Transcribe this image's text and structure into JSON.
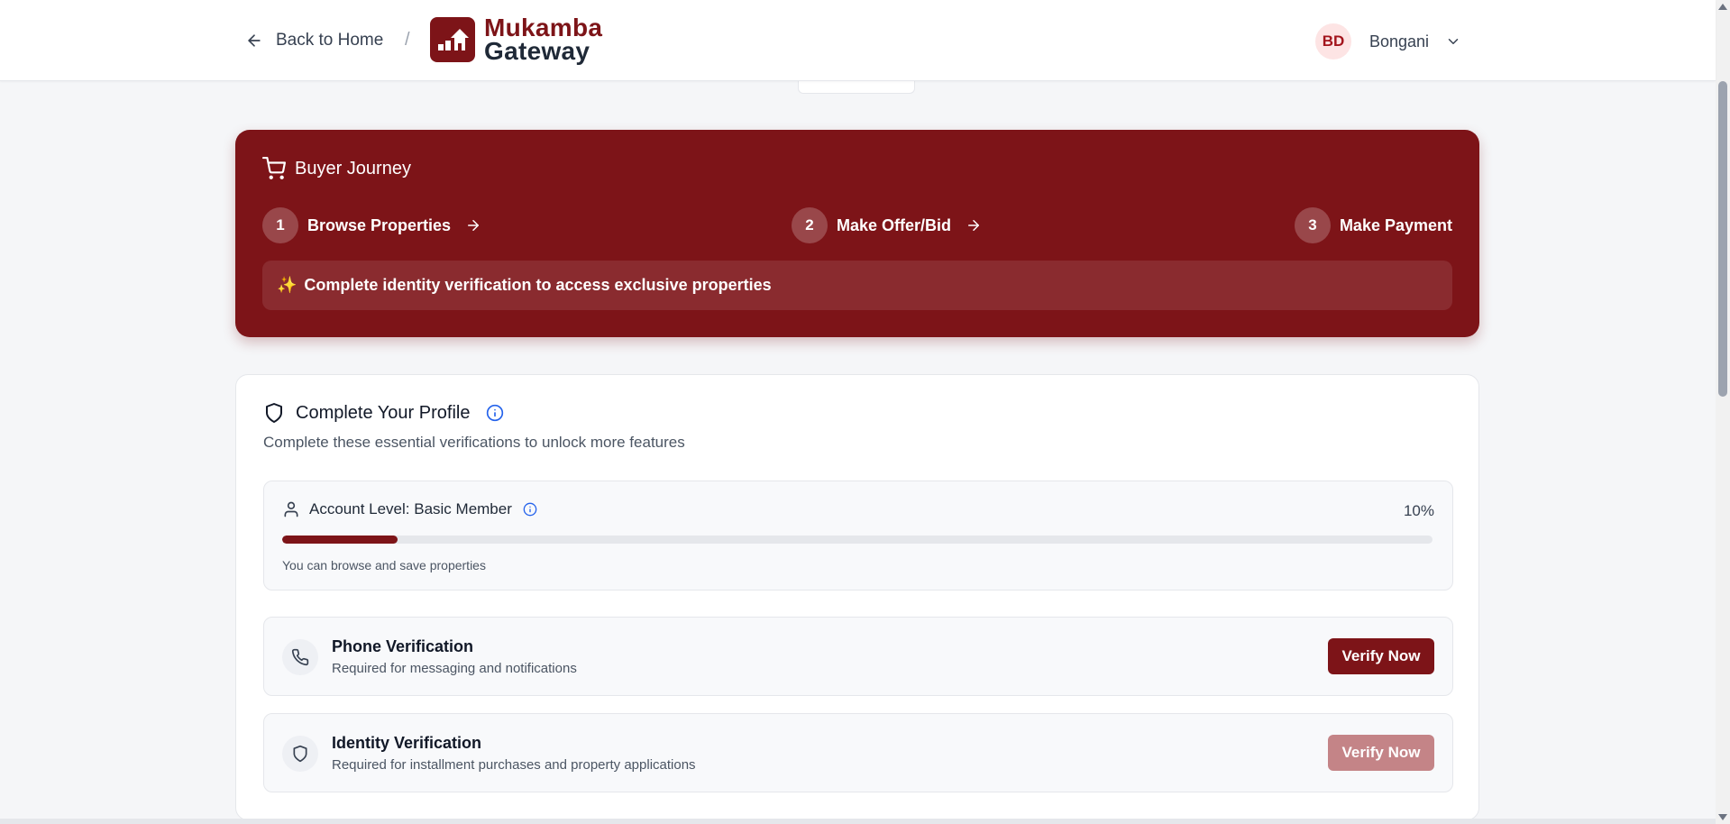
{
  "header": {
    "back_label": "Back to Home",
    "separator": "/",
    "logo_line1": "Mukamba",
    "logo_line2": "Gateway",
    "user_initials": "BD",
    "user_name": "Bongani"
  },
  "journey": {
    "title": "Buyer Journey",
    "steps": [
      {
        "number": "1",
        "label": "Browse Properties"
      },
      {
        "number": "2",
        "label": "Make Offer/Bid"
      },
      {
        "number": "3",
        "label": "Make Payment"
      }
    ],
    "note_icon": "✨",
    "note": "Complete identity verification to access exclusive properties"
  },
  "profile": {
    "title": "Complete Your Profile",
    "subtitle": "Complete these essential verifications to unlock more features",
    "level": {
      "label": "Account Level: Basic Member",
      "percent_label": "10%",
      "progress": 0.1,
      "description": "You can browse and save properties"
    },
    "verifications": [
      {
        "title": "Phone Verification",
        "description": "Required for messaging and notifications",
        "button": "Verify Now",
        "icon": "phone-icon",
        "enabled": true
      },
      {
        "title": "Identity Verification",
        "description": "Required for installment purchases and property applications",
        "button": "Verify Now",
        "icon": "shield-icon",
        "enabled": false
      }
    ]
  },
  "colors": {
    "brand": "#7d1418",
    "brand_disabled": "#c48487",
    "avatar_bg": "#fde4e4",
    "info_blue": "#2563eb"
  }
}
